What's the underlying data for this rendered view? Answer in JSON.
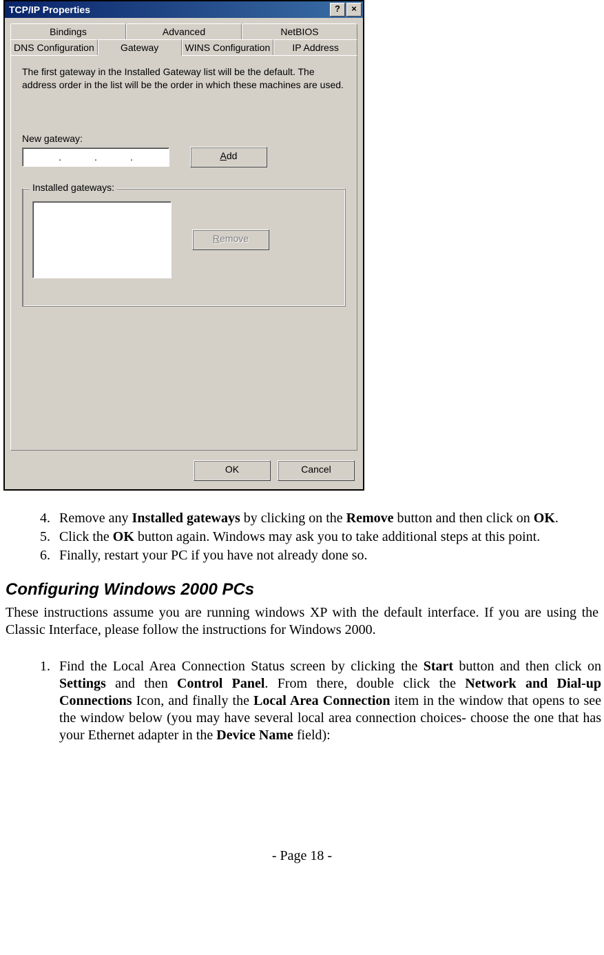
{
  "dialog": {
    "title": "TCP/IP Properties",
    "help_btn": "?",
    "close_btn": "×",
    "tabs_row1": [
      "Bindings",
      "Advanced",
      "NetBIOS"
    ],
    "tabs_row2": [
      "DNS Configuration",
      "Gateway",
      "WINS Configuration",
      "IP Address"
    ],
    "active_tab": "Gateway",
    "description": "The first gateway in the Installed Gateway list will be the default. The address order in the list will be the order in which these machines are used.",
    "new_gateway_label": "New gateway:",
    "add_btn_prefix": "A",
    "add_btn_rest": "dd",
    "installed_gateways_label": "Installed gateways:",
    "remove_btn_prefix": "R",
    "remove_btn_rest": "emove",
    "ok_btn": "OK",
    "cancel_btn": "Cancel"
  },
  "doc": {
    "list_a_start": 4,
    "item4_a": "Remove any ",
    "item4_b": "Installed gateways",
    "item4_c": " by clicking on the ",
    "item4_d": "Remove",
    "item4_e": " button and then click on ",
    "item4_f": "OK",
    "item4_g": ".",
    "item5_a": "Click the ",
    "item5_b": "OK",
    "item5_c": " button again. Windows may ask you to take additional steps at this point.",
    "item6": "Finally, restart your PC if you have not already done so.",
    "heading": "Configuring Windows 2000 PCs",
    "para1": "These instructions assume you are running windows XP with the default interface.  If you are using the Classic Interface, please follow the instructions for Windows 2000.",
    "list_b_start": 1,
    "item1_a": "Find the Local Area Connection Status screen by clicking the ",
    "item1_b": "Start",
    "item1_c": " button and then click on ",
    "item1_d": "Settings",
    "item1_e": " and then ",
    "item1_f": "Control Panel",
    "item1_g": ". From there, double click the ",
    "item1_h": "Network and Dial-up Connections",
    "item1_i": " Icon, and finally the ",
    "item1_j": "Local Area Connection",
    "item1_k": " item in the window that opens to see the window below (you may have several local area connection choices- choose the one that has your Ethernet adapter in the ",
    "item1_l": "Device Name",
    "item1_m": " field):",
    "footer": "- Page 18 -"
  }
}
